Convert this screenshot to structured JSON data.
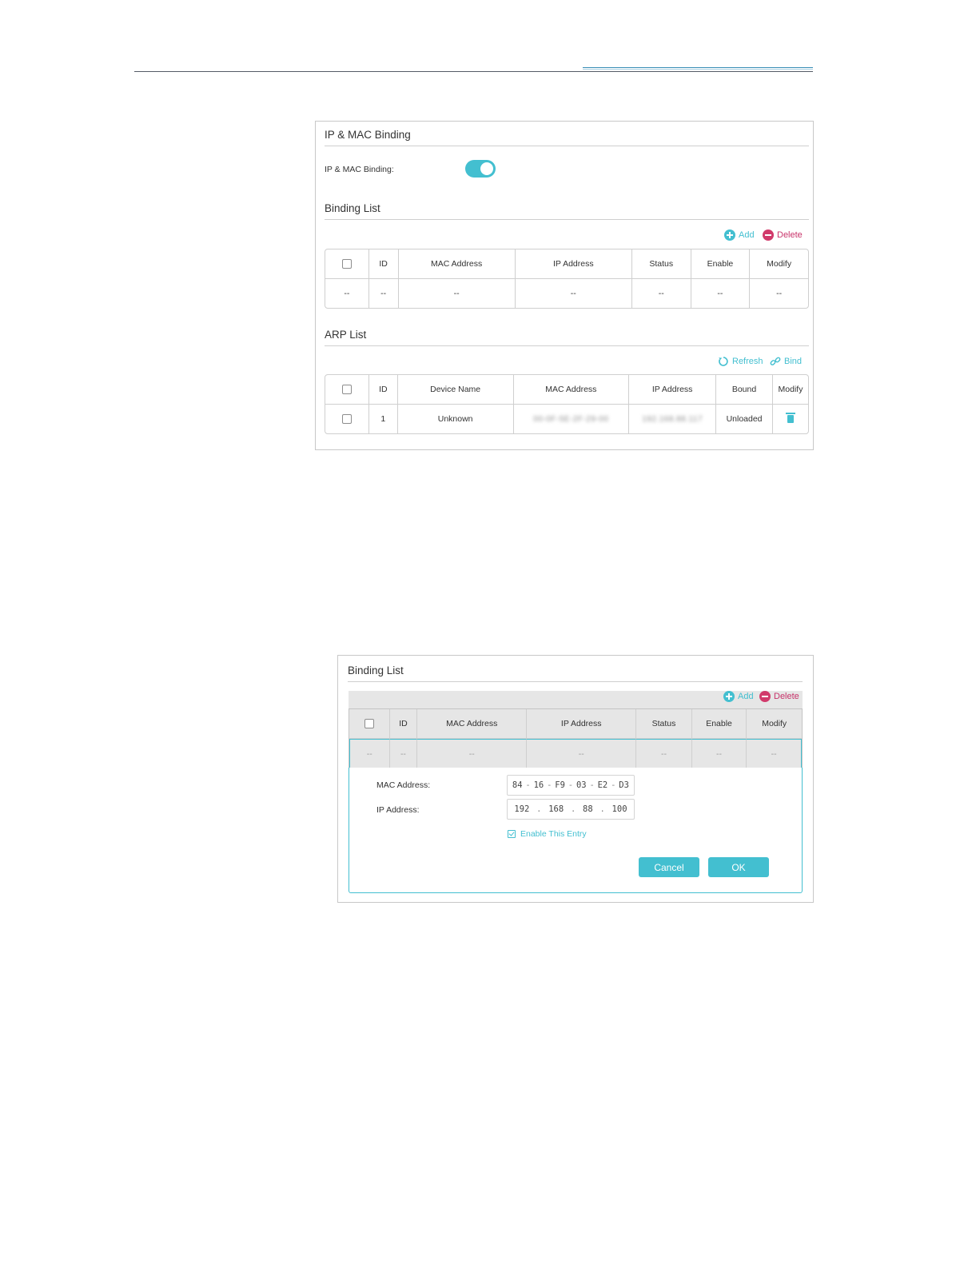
{
  "panel1": {
    "title": "IP & MAC Binding",
    "toggle_label": "IP & MAC Binding:",
    "toggle_on": true,
    "binding_list": {
      "title": "Binding List",
      "add_label": "Add",
      "delete_label": "Delete",
      "columns": [
        "ID",
        "MAC Address",
        "IP Address",
        "Status",
        "Enable",
        "Modify"
      ],
      "empty_row": [
        "--",
        "--",
        "--",
        "--",
        "--",
        "--",
        "--"
      ]
    },
    "arp_list": {
      "title": "ARP List",
      "refresh_label": "Refresh",
      "bind_label": "Bind",
      "columns": [
        "ID",
        "Device Name",
        "MAC Address",
        "IP Address",
        "Bound",
        "Modify"
      ],
      "rows": [
        {
          "id": "1",
          "device_name": "Unknown",
          "mac": "00-0F-5E-2F-29-00",
          "ip": "192.168.88.117",
          "bound": "Unloaded"
        }
      ]
    }
  },
  "panel2": {
    "title": "Binding List",
    "add_label": "Add",
    "delete_label": "Delete",
    "columns": [
      "ID",
      "MAC Address",
      "IP Address",
      "Status",
      "Enable",
      "Modify"
    ],
    "empty_row": [
      "--",
      "--",
      "--",
      "--",
      "--",
      "--",
      "--"
    ],
    "form": {
      "mac_label": "MAC Address:",
      "mac_parts": [
        "84",
        "16",
        "F9",
        "03",
        "E2",
        "D3"
      ],
      "ip_label": "IP Address:",
      "ip_parts": [
        "192",
        "168",
        "88",
        "100"
      ],
      "enable_entry_label": "Enable This Entry",
      "cancel_label": "Cancel",
      "ok_label": "OK"
    }
  },
  "colors": {
    "accent": "#43bfd0",
    "delete": "#c8336a",
    "header_rule": "#555b66"
  }
}
